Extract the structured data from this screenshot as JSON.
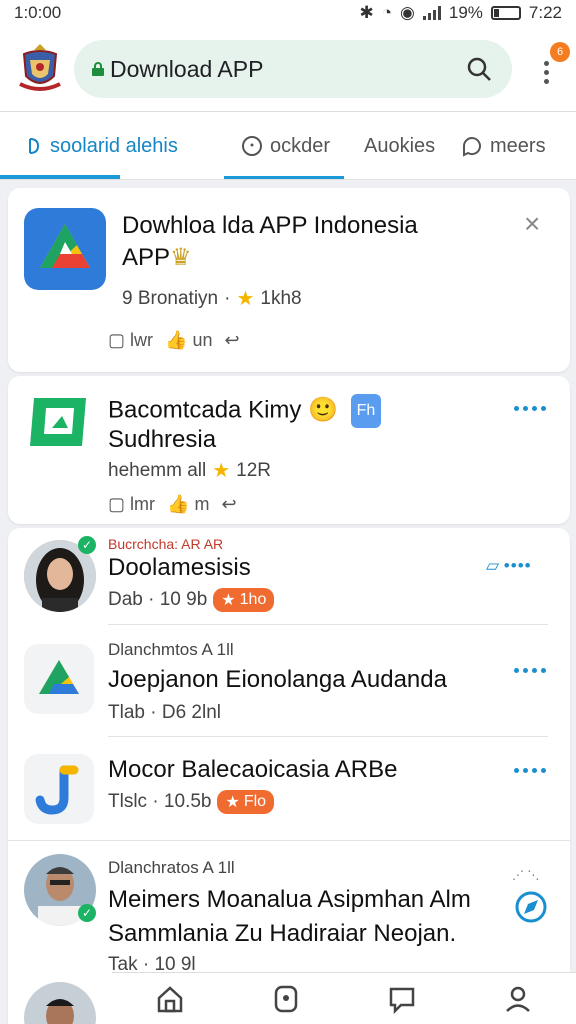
{
  "status_bar": {
    "time_left": "1:0:00",
    "battery_pct": "19%",
    "clock": "7:22",
    "battery_fill": 0.19
  },
  "search": {
    "text": "Download APP"
  },
  "notification_count": "6",
  "tabs": [
    {
      "label": "soolarid alehis",
      "active": true
    },
    {
      "label": "ockder",
      "active": false
    },
    {
      "label": "Auokies",
      "active": false
    },
    {
      "label": "meers",
      "active": false
    }
  ],
  "featured": {
    "title_line1": "Dowhloa lda APP Indonesia",
    "title_line2": "APP",
    "meta_prefix": "9 Bronatiyn",
    "meta_rating": "1kh8",
    "action1": "lwr",
    "action2": "un"
  },
  "card2": {
    "title_line1": "Bacomtcada Kimy",
    "badge": "Fh",
    "title_line2": "Sudhresia",
    "meta_prefix": "hehemm all",
    "meta_rating": "12R",
    "action1": "lmr",
    "action2": "m"
  },
  "list": [
    {
      "tag": "Bucrchcha: AR AR",
      "title": "Doolamesisis",
      "meta": "Dab  ·  10 9b",
      "badge": "1ho"
    },
    {
      "tag": "Dlanchmtos A 1ll",
      "title": "Joepjanon Eionolanga Audanda",
      "meta": "Tlab  ·  D6 2lnl"
    },
    {
      "title": "Mocor Balecaoicasia ARBe",
      "meta": "Tlslc  ·  10.5b",
      "badge": "Flo"
    },
    {
      "tag": "Dlanchratos A 1ll",
      "title_line1": "Meimers Moanalua Asipmhan Alm",
      "title_line2": "Sammlania Zu Hadiraiar Neojan.",
      "meta": "Tak  ·  10 9l"
    }
  ],
  "colors": {
    "accent": "#1a9bd7",
    "orange": "#f06b2f",
    "green": "#1e8e3e"
  }
}
